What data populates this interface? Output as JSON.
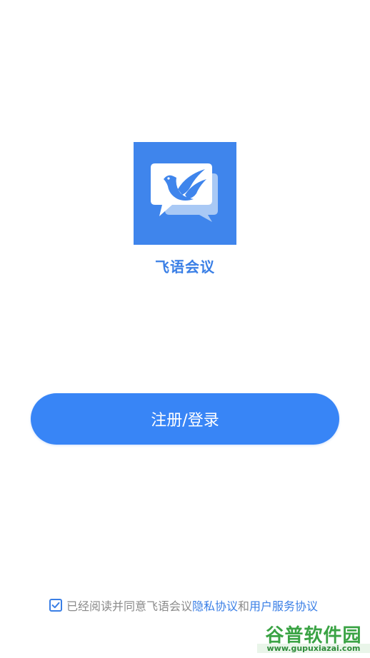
{
  "app": {
    "name": "飞语会议",
    "brand_color": "#3f85ec",
    "logo_icon": "bird-chat-bubble-icon"
  },
  "actions": {
    "login_label": "注册/登录",
    "login_color": "#3885f6"
  },
  "agreement": {
    "checked": true,
    "prefix": "已经阅读并同意飞语会议",
    "privacy_link": "隐私协议",
    "conjunction": "和",
    "service_link": "用户服务协议"
  },
  "watermark": {
    "text": "谷普软件园",
    "url": "www.gupuxiazai.com"
  }
}
